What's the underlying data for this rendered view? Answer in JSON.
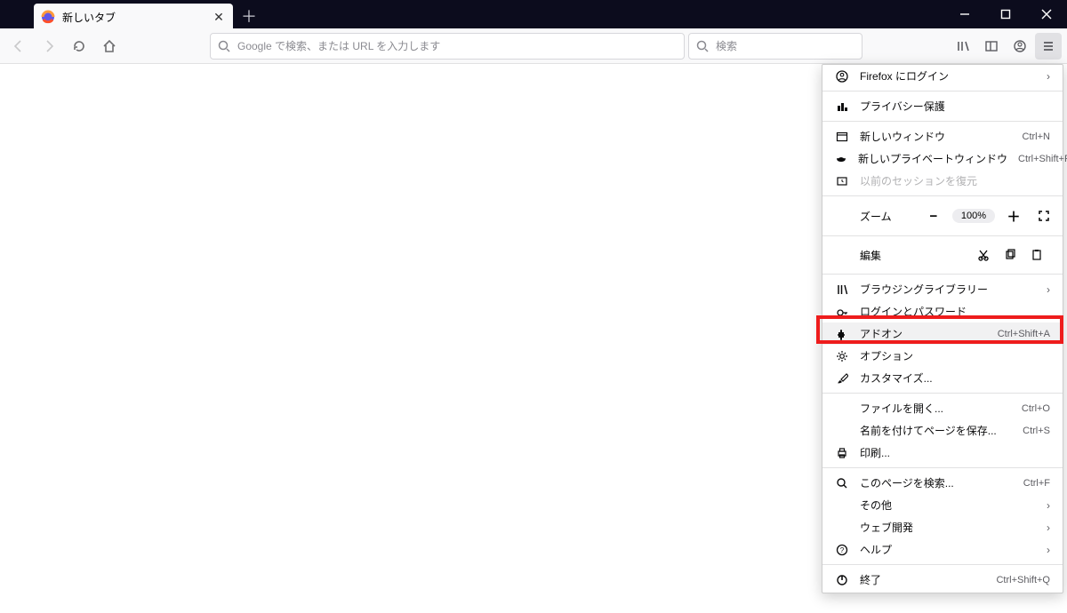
{
  "tab": {
    "title": "新しいタブ"
  },
  "urlbar": {
    "placeholder": "Google で検索、または URL を入力します"
  },
  "searchbar": {
    "placeholder": "検索"
  },
  "menu": {
    "signin": "Firefox にログイン",
    "privacy": "プライバシー保護",
    "newwindow": {
      "label": "新しいウィンドウ",
      "shortcut": "Ctrl+N"
    },
    "newprivate": {
      "label": "新しいプライベートウィンドウ",
      "shortcut": "Ctrl+Shift+P"
    },
    "restore": "以前のセッションを復元",
    "zoom": {
      "label": "ズーム",
      "value": "100%"
    },
    "edit": {
      "label": "編集"
    },
    "library": "ブラウジングライブラリー",
    "logins": "ログインとパスワード",
    "addons": {
      "label": "アドオン",
      "shortcut": "Ctrl+Shift+A"
    },
    "options": "オプション",
    "customize": "カスタマイズ...",
    "openfile": {
      "label": "ファイルを開く...",
      "shortcut": "Ctrl+O"
    },
    "saveas": {
      "label": "名前を付けてページを保存...",
      "shortcut": "Ctrl+S"
    },
    "print": "印刷...",
    "find": {
      "label": "このページを検索...",
      "shortcut": "Ctrl+F"
    },
    "more": "その他",
    "webdev": "ウェブ開発",
    "help": "ヘルプ",
    "exit": {
      "label": "終了",
      "shortcut": "Ctrl+Shift+Q"
    }
  }
}
